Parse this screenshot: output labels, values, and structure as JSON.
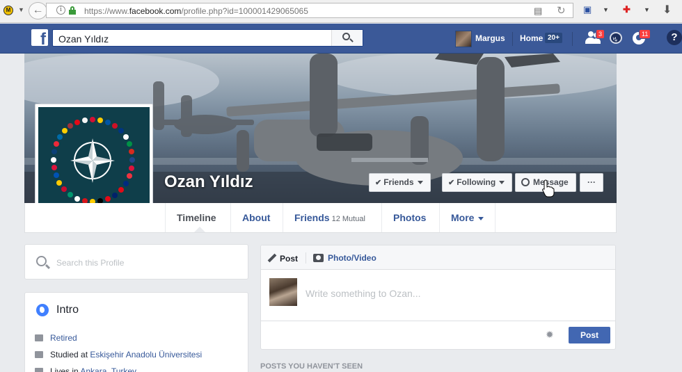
{
  "browser": {
    "url_prefix": "https://www.",
    "url_domain": "facebook.com",
    "url_path": "/profile.php?id=100001429065065"
  },
  "header": {
    "search_value": "Ozan Yıldız",
    "user_name": "Margus",
    "home_label": "Home",
    "home_count": "20+",
    "friend_requests_count": "3",
    "notifications_count": "11",
    "help_label": "?"
  },
  "profile": {
    "name": "Ozan Yıldız",
    "friends_button": "Friends",
    "following_button": "Following",
    "message_button": "Message",
    "more_button": "···"
  },
  "timeline_nav": {
    "tabs": [
      {
        "label": "Timeline"
      },
      {
        "label": "About"
      },
      {
        "label": "Friends",
        "mutual": "12 Mutual"
      },
      {
        "label": "Photos"
      },
      {
        "label": "More"
      }
    ]
  },
  "left_column": {
    "search_placeholder": "Search this Profile",
    "intro_title": "Intro",
    "intro_items": [
      {
        "prefix": "",
        "link": "Retired",
        "suffix": ""
      },
      {
        "prefix": "Studied at ",
        "link": "Eskişehir Anadolu Üniversitesi",
        "suffix": ""
      },
      {
        "prefix": "Lives in ",
        "link": "Ankara, Turkey",
        "suffix": ""
      }
    ]
  },
  "composer": {
    "tab_post": "Post",
    "tab_photo": "Photo/Video",
    "placeholder": "Write something to Ozan...",
    "post_button": "Post"
  },
  "feed": {
    "section_title": "POSTS YOU HAVEN'T SEEN"
  },
  "colors": {
    "facebook_blue": "#3b5998",
    "link_blue": "#365899",
    "button_blue": "#4267b2",
    "badge_red": "#fa3e3e"
  }
}
